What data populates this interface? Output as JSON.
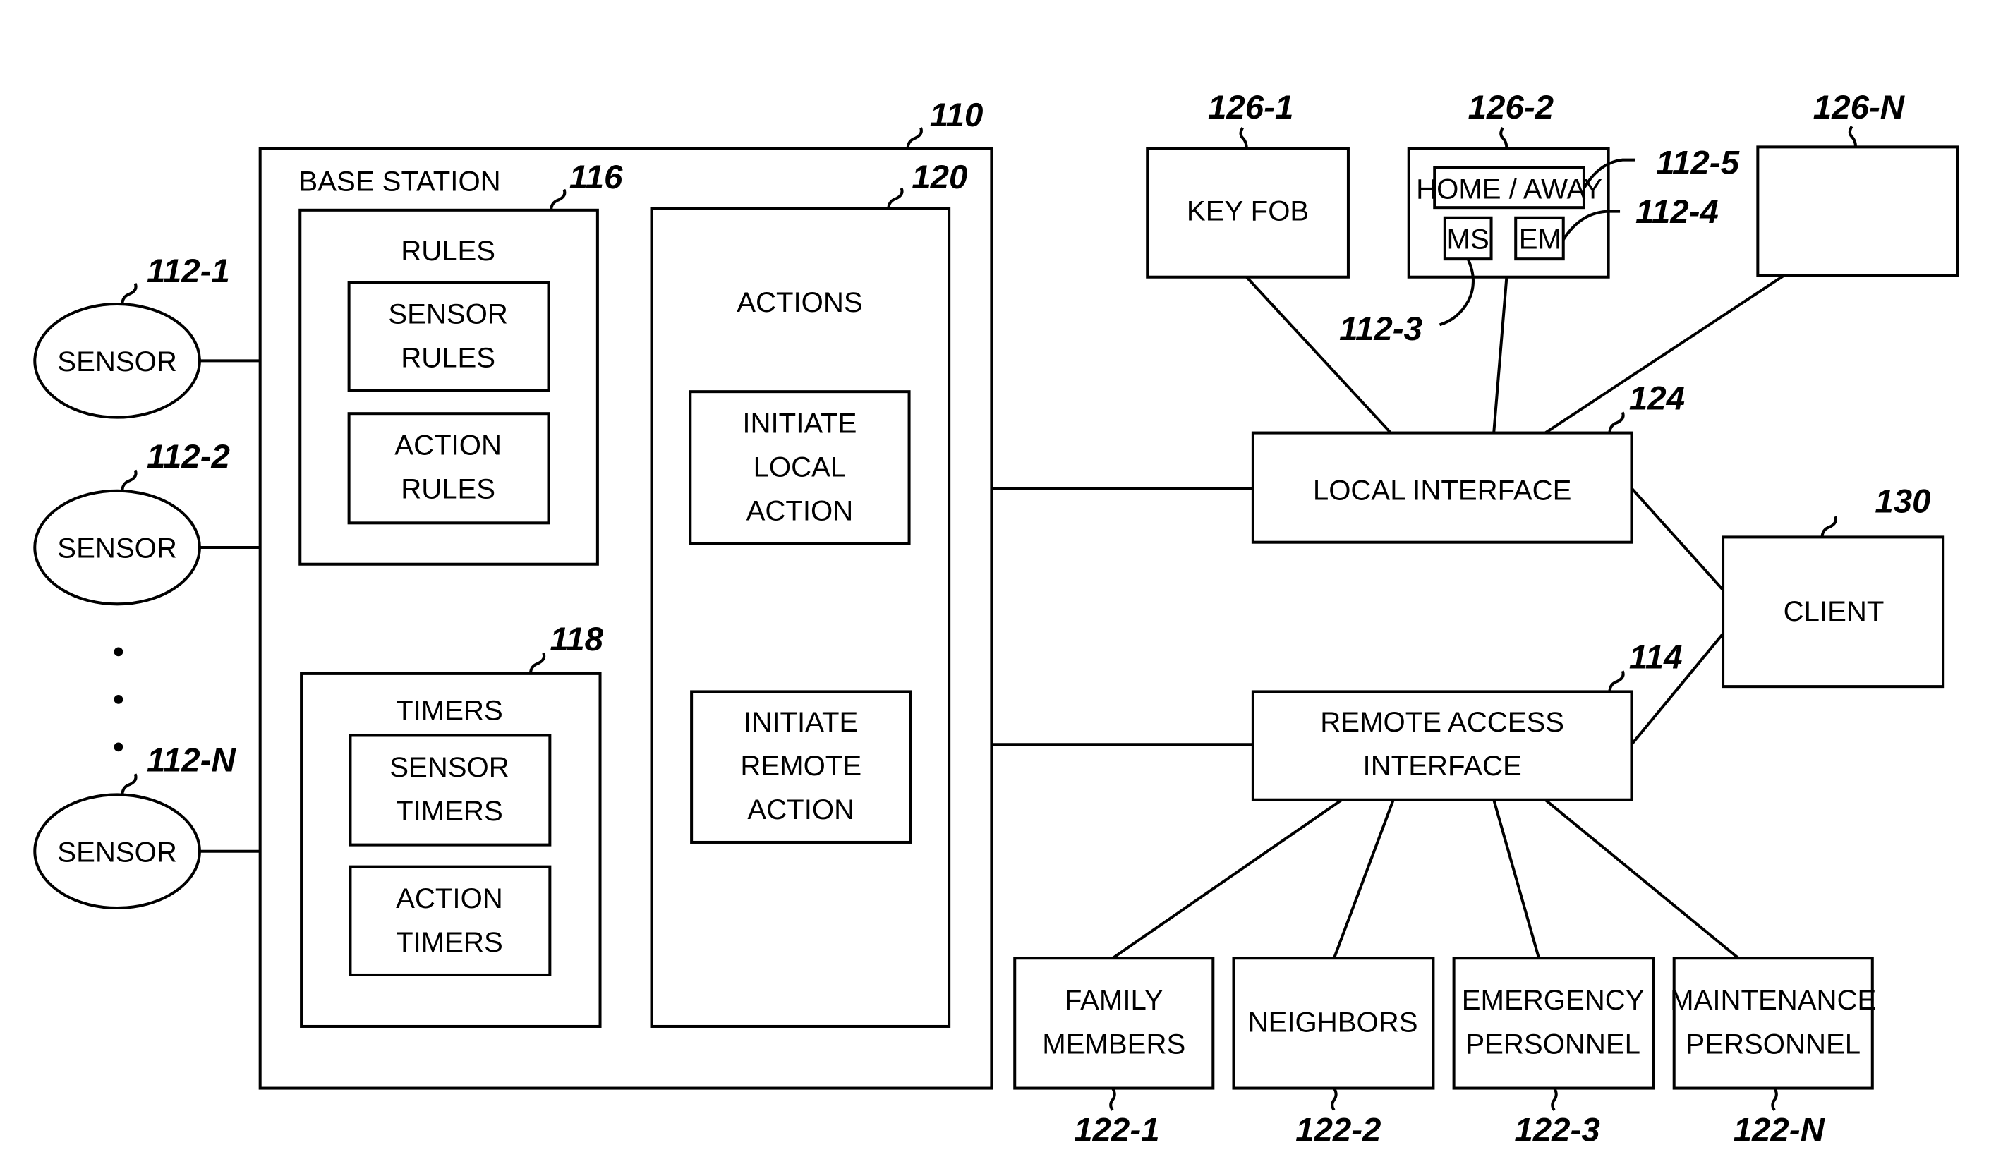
{
  "figure": {
    "base_station": {
      "ref": "110",
      "title": "BASE STATION"
    },
    "rules": {
      "ref": "116",
      "title": "RULES",
      "items": [
        [
          "SENSOR",
          "RULES"
        ],
        [
          "ACTION",
          "RULES"
        ]
      ]
    },
    "timers": {
      "ref": "118",
      "title": "TIMERS",
      "items": [
        [
          "SENSOR",
          "TIMERS"
        ],
        [
          "ACTION",
          "TIMERS"
        ]
      ]
    },
    "actions": {
      "ref": "120",
      "title": "ACTIONS",
      "items": [
        [
          "INITIATE",
          "LOCAL",
          "ACTION"
        ],
        [
          "INITIATE",
          "REMOTE",
          "ACTION"
        ]
      ]
    },
    "sensors": [
      {
        "ref": "112-1",
        "label": "SENSOR"
      },
      {
        "ref": "112-2",
        "label": "SENSOR"
      },
      {
        "ref": "112-N",
        "label": "SENSOR"
      }
    ],
    "local_devices": [
      {
        "ref": "126-1",
        "label": "KEY FOB"
      },
      {
        "ref": "126-2",
        "label": ""
      },
      {
        "ref": "126-N",
        "label": ""
      }
    ],
    "keypad": {
      "home_away": {
        "ref": "112-5",
        "label": "HOME / AWAY"
      },
      "ms": {
        "ref": "112-3",
        "label": "MS"
      },
      "em": {
        "ref": "112-4",
        "label": "EM"
      }
    },
    "local_interface": {
      "ref": "124",
      "label": "LOCAL INTERFACE"
    },
    "remote_interface": {
      "ref": "114",
      "label": [
        "REMOTE ACCESS",
        "INTERFACE"
      ]
    },
    "client": {
      "ref": "130",
      "label": "CLIENT"
    },
    "remote_parties": [
      {
        "ref": "122-1",
        "label": [
          "FAMILY",
          "MEMBERS"
        ]
      },
      {
        "ref": "122-2",
        "label": [
          "NEIGHBORS"
        ]
      },
      {
        "ref": "122-3",
        "label": [
          "EMERGENCY",
          "PERSONNEL"
        ]
      },
      {
        "ref": "122-N",
        "label": [
          "MAINTENANCE",
          "PERSONNEL"
        ]
      }
    ]
  }
}
